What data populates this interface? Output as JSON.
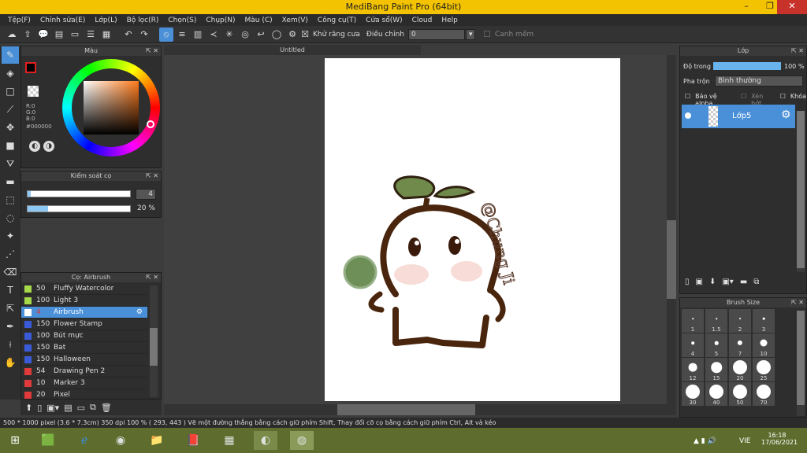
{
  "window": {
    "title": "MediBang Paint Pro (64bit)",
    "min": "–",
    "max": "❐",
    "close": "✕"
  },
  "menu": [
    "Tệp(F)",
    "Chỉnh sửa(E)",
    "Lớp(L)",
    "Bộ lọc(R)",
    "Chọn(S)",
    "Chụp(N)",
    "Màu (C)",
    "Xem(V)",
    "Công cụ(T)",
    "Cửa sổ(W)",
    "Cloud",
    "Help"
  ],
  "toolbar": {
    "antialias_label": "Khử răng cưa",
    "adjust_label": "Điều chỉnh",
    "adjust_value": "0",
    "snap_label": "Canh mềm"
  },
  "color_panel": {
    "title": "Màu",
    "r": "R:0",
    "g": "G:0",
    "b": "B:0",
    "hex": "#000000"
  },
  "brush_control": {
    "title": "Kiểm soát cọ",
    "size_value": "4",
    "opacity_value": "20 %"
  },
  "brush_panel": {
    "title": "Cọ: Airbrush",
    "items": [
      {
        "size": "50",
        "name": "Fluffy Watercolor",
        "color": "#a6d94a"
      },
      {
        "size": "100",
        "name": "Light 3",
        "color": "#a6d94a"
      },
      {
        "size": "4",
        "name": "Airbrush",
        "color": "#ffffff",
        "selected": true
      },
      {
        "size": "150",
        "name": "Flower Stamp",
        "color": "#3a5bd9"
      },
      {
        "size": "100",
        "name": "Bút mực",
        "color": "#3a5bd9"
      },
      {
        "size": "150",
        "name": "Bat",
        "color": "#3a5bd9"
      },
      {
        "size": "150",
        "name": "Halloween",
        "color": "#3a5bd9"
      },
      {
        "size": "54",
        "name": "Drawing Pen 2",
        "color": "#e03a3a"
      },
      {
        "size": "10",
        "name": "Marker 3",
        "color": "#e03a3a"
      },
      {
        "size": "20",
        "name": "Pixel",
        "color": "#e03a3a"
      }
    ]
  },
  "document": {
    "tab": "Untitled",
    "signature": "@Chung Ji"
  },
  "layer_panel": {
    "title": "Lớp",
    "opacity_label": "Độ trong",
    "opacity_value": "100 %",
    "blend_label": "Pha trộn",
    "blend_value": "Bình thường",
    "protect_alpha": "Bảo vệ alpha",
    "clip": "Xén bớt",
    "lock": "Khóa",
    "layer_name": "Lớp5"
  },
  "brush_size_panel": {
    "title": "Brush Size",
    "sizes": [
      "1",
      "1.5",
      "2",
      "3",
      "4",
      "5",
      "7",
      "10",
      "12",
      "15",
      "20",
      "25",
      "30",
      "40",
      "50",
      "70"
    ]
  },
  "status": {
    "text": "500 * 1000 pixel   (3.6 * 7.3cm)   350 dpi   100 %   ( 293, 443 )   Vẽ một đường thẳng bằng cách giữ phím Shift, Thay đổi cỡ cọ bằng cách giữ phím Ctrl, Alt và kéo"
  },
  "taskbar": {
    "lang": "VIE",
    "time": "16:18",
    "date": "17/06/2021"
  }
}
